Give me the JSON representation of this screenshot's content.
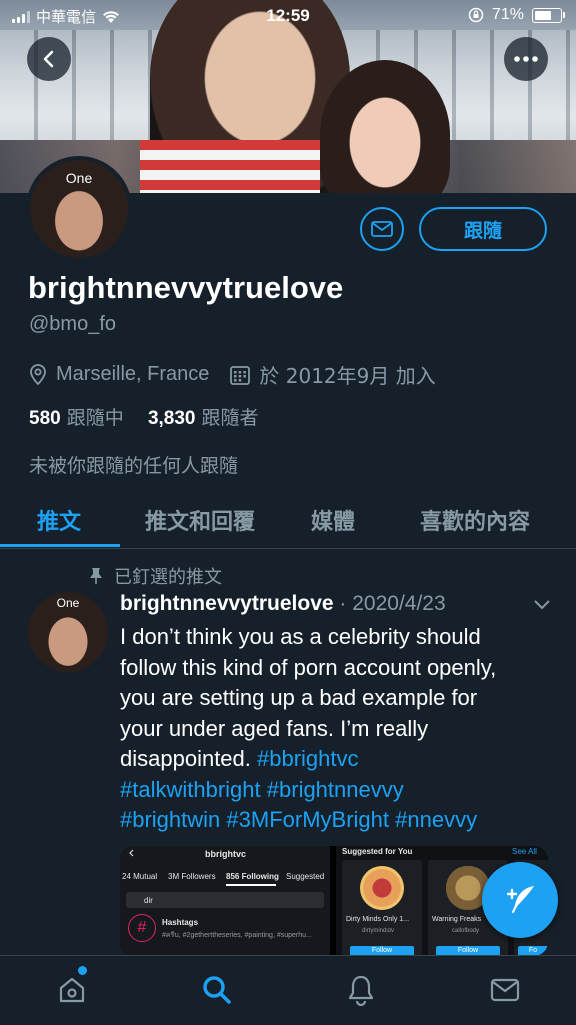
{
  "status_bar": {
    "carrier": "中華電信",
    "time": "12:59",
    "battery": "71%",
    "battery_level": 0.71
  },
  "banner": {
    "avatar_label": "One"
  },
  "profile": {
    "follow_label": "跟隨",
    "display_name": "brightnnevvytruelove",
    "handle": "@bmo_fo",
    "location": "Marseille, France",
    "joined": "於 2012年9月 加入",
    "following_count": "580",
    "following_label": "跟隨中",
    "followers_count": "3,830",
    "followers_label": "跟隨者",
    "not_followed_text": "未被你跟隨的任何人跟隨"
  },
  "tabs": [
    {
      "label": "推文",
      "active": true
    },
    {
      "label": "推文和回覆",
      "active": false
    },
    {
      "label": "媒體",
      "active": false
    },
    {
      "label": "喜歡的內容",
      "active": false
    }
  ],
  "pinned_tweet": {
    "pinned_label": "已釘選的推文",
    "avatar_label": "One",
    "author": "brightnnevvytruelove",
    "separator": " · ",
    "date": "2020/4/23",
    "text_line1": "I don’t think you as a celebrity should",
    "text_line2": "follow this kind of porn account openly,",
    "text_line3": "you are setting up a bad example for",
    "text_line4": "your under aged fans. I’m really",
    "text_line5": "disappointed. ",
    "tag1": "#bbrightvc",
    "tag2": "#talkwithbright",
    "tag3": "#brightnnevvy",
    "tag4": "#brightwin",
    "tag5": "#3MForMyBright",
    "tag6": "#nnevvy",
    "media": {
      "left": {
        "title": "bbrightvc",
        "tab_mutual": "24 Mutual",
        "tab_followers": "3M Followers",
        "tab_following": "856 Following",
        "tab_suggested": "Suggested",
        "search_text": "dir",
        "hashtags_title": "Hashtags",
        "hashtags_sub": "#ครีบ, #2getherttheseries, #painting, #superhu..."
      },
      "right": {
        "header": "Suggested for You",
        "see_all": "See All",
        "card1_name": "Dirty Minds Only 1...",
        "card1_handle": "dirtymindstv",
        "card2_name": "Warning Freaks",
        "card2_handle": "callofbody",
        "follow": "Follow",
        "follow_short": "Fo"
      }
    }
  },
  "colors": {
    "background": "#15202b",
    "accent": "#1da1f2",
    "muted": "#8899a6",
    "divider": "#38444d"
  },
  "icons": [
    "back-arrow-icon",
    "more-icon",
    "mail-icon",
    "location-pin-icon",
    "calendar-icon",
    "pin-icon",
    "chevron-down-icon",
    "compose-tweet-icon",
    "home-icon",
    "search-icon",
    "notifications-bell-icon",
    "messages-icon"
  ]
}
